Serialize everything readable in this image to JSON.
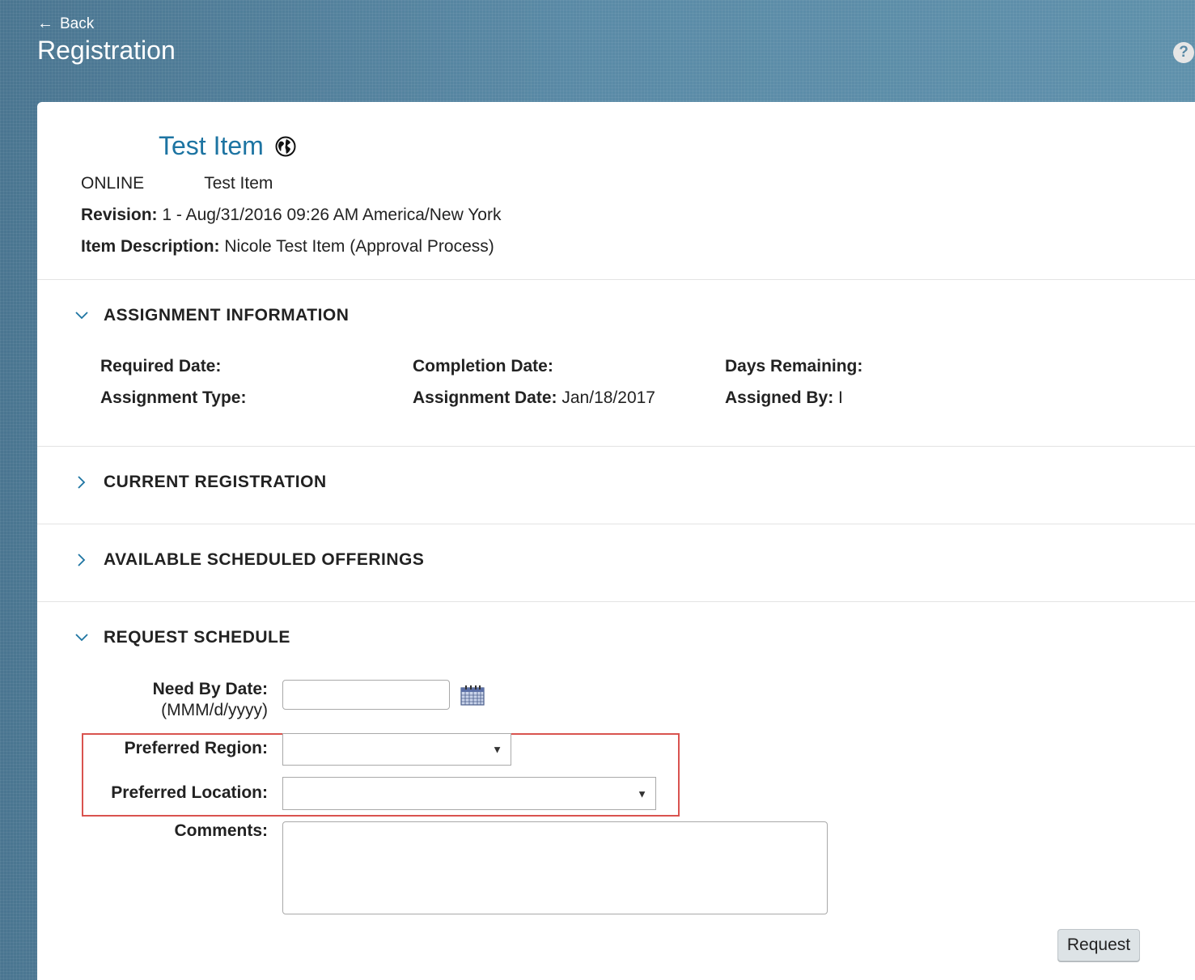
{
  "header": {
    "back_label": "Back",
    "page_title": "Registration",
    "help_icon": "?"
  },
  "item": {
    "title": "Test Item",
    "type": "ONLINE",
    "name": "Test Item",
    "revision_label": "Revision:",
    "revision_value": "1 - Aug/31/2016 09:26 AM America/New York",
    "description_label": "Item Description:",
    "description_value": "Nicole Test Item (Approval Process)"
  },
  "sections": {
    "assignment": {
      "label": "ASSIGNMENT INFORMATION",
      "expanded": true,
      "required_date_label": "Required Date:",
      "required_date_value": "",
      "completion_date_label": "Completion Date:",
      "completion_date_value": "",
      "days_remaining_label": "Days Remaining:",
      "days_remaining_value": "",
      "assignment_type_label": "Assignment Type:",
      "assignment_type_value": "",
      "assignment_date_label": "Assignment Date:",
      "assignment_date_value": "Jan/18/2017",
      "assigned_by_label": "Assigned By:",
      "assigned_by_value": "I"
    },
    "current_registration": {
      "label": "CURRENT REGISTRATION",
      "expanded": false
    },
    "available_offerings": {
      "label": "AVAILABLE SCHEDULED OFFERINGS",
      "expanded": false
    },
    "request_schedule": {
      "label": "REQUEST SCHEDULE",
      "expanded": true,
      "need_by_label": "Need By Date:",
      "need_by_format": "(MMM/d/yyyy)",
      "need_by_value": "",
      "region_label": "Preferred Region:",
      "region_value": "",
      "location_label": "Preferred Location:",
      "location_value": "",
      "comments_label": "Comments:",
      "comments_value": "",
      "request_button": "Request"
    }
  },
  "colors": {
    "title_blue": "#1d74a2",
    "highlight_red": "#d9534f",
    "header_bg": "#4f7d99"
  }
}
